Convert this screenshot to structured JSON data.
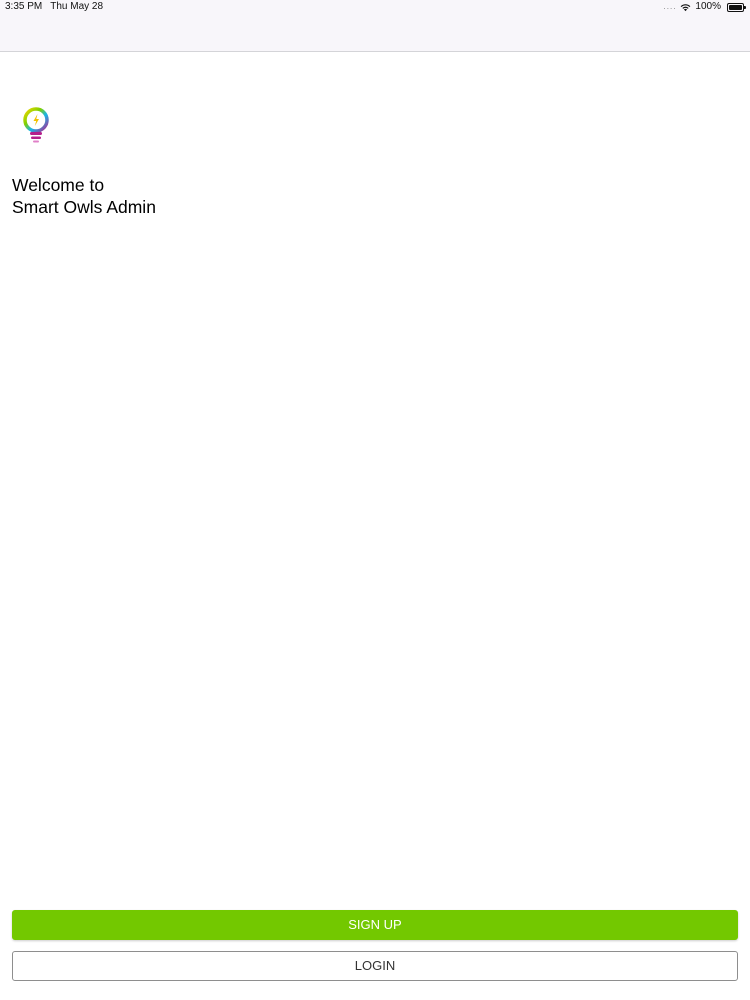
{
  "status_bar": {
    "time": "3:35 PM",
    "date": "Thu May 28",
    "battery": "100%",
    "icons": [
      "signal-dots-icon",
      "wifi-icon",
      "battery-icon"
    ]
  },
  "welcome": {
    "line1": "Welcome to",
    "line2": "Smart Owls Admin"
  },
  "buttons": {
    "signup_label": "SIGN UP",
    "login_label": "LOGIN"
  },
  "colors": {
    "signup_green": "#73c800",
    "login_border": "#8e8e8e",
    "nav_background": "#f8f6fa"
  }
}
